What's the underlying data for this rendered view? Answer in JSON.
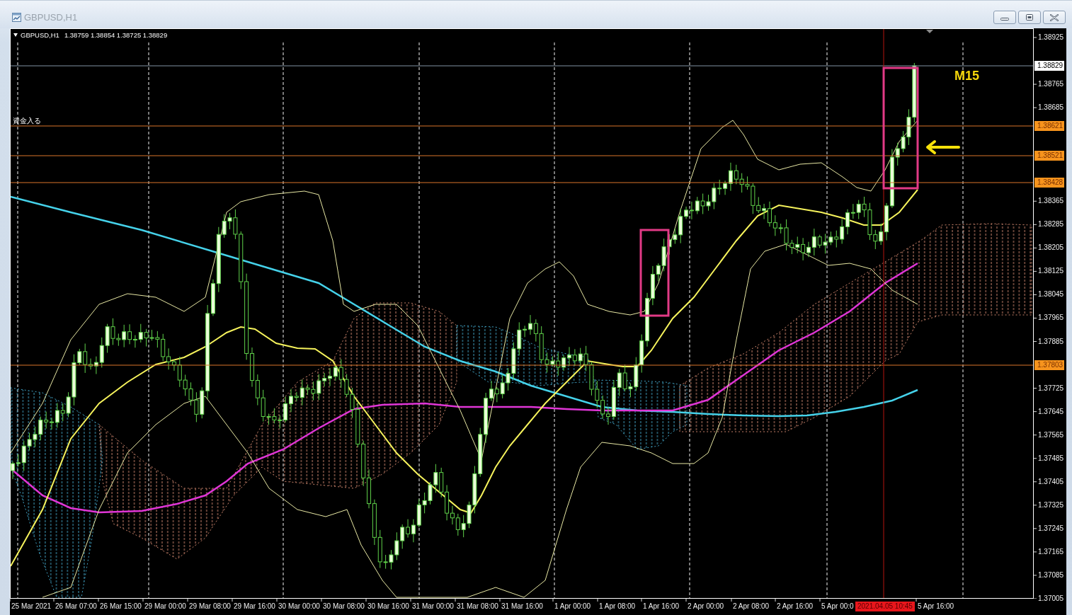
{
  "window": {
    "title": "GBPUSD,H1",
    "active": false
  },
  "chart": {
    "symbol": "GBPUSD,H1",
    "ohlc": "1.38759 1.38854 1.38725 1.38829",
    "timeframe_note": "M15",
    "price_ticks": [
      "1.38925",
      "1.38765",
      "1.38685",
      "1.38365",
      "1.38285",
      "1.38205",
      "1.38125",
      "1.38045",
      "1.37965",
      "1.37885",
      "1.37725",
      "1.37645",
      "1.37565",
      "1.37485",
      "1.37405",
      "1.37325",
      "1.37245",
      "1.37165",
      "1.37085",
      "1.37005"
    ],
    "price_levels": [
      {
        "kind": "bid",
        "label": "1.38829"
      },
      {
        "kind": "level",
        "label": "1.38621",
        "note": "資金入る"
      },
      {
        "kind": "level",
        "label": "1.38521"
      },
      {
        "kind": "level",
        "label": "1.38428"
      },
      {
        "kind": "level",
        "label": "1.37803"
      }
    ],
    "time_labels": [
      "25 Mar 2021",
      "26 Mar 07:00",
      "26 Mar 15:00",
      "29 Mar 00:00",
      "29 Mar 08:00",
      "29 Mar 16:00",
      "30 Mar 00:00",
      "30 Mar 08:00",
      "30 Mar 16:00",
      "31 Mar 00:00",
      "31 Mar 08:00",
      "31 Mar 16:00",
      "1 Apr 00:00",
      "1 Apr 08:00",
      "1 Apr 16:00",
      "2 Apr 00:00",
      "2 Apr 08:00",
      "2 Apr 16:00",
      "5 Apr 00:0",
      "5 Apr 16:00"
    ],
    "cursor_time": "2021.04.05 10:45"
  }
}
